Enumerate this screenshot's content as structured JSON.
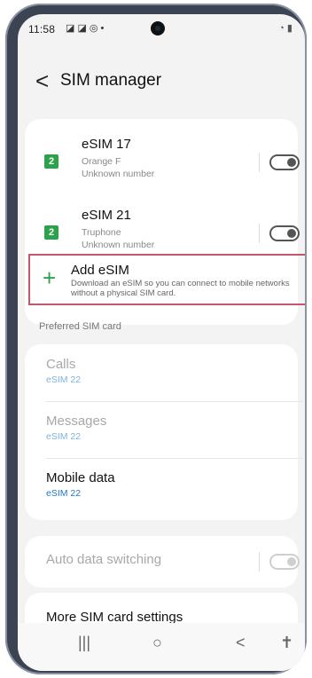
{
  "status": {
    "time": "11:58",
    "left_icons": "◪ ◪ ◎ •",
    "right_icons": "◔ ▮"
  },
  "header": {
    "back_icon": "chevron-left-icon",
    "title": "SIM manager"
  },
  "sims": [
    {
      "name": "eSIM 17",
      "carrier": "Orange F",
      "number": "Unknown number",
      "toggle": "off"
    },
    {
      "name": "eSIM 21",
      "carrier": "Truphone",
      "number": "Unknown number",
      "toggle": "off"
    }
  ],
  "add_esim": {
    "title": "Add eSIM",
    "description": "Download an eSIM so you can connect to mobile networks without a physical SIM card."
  },
  "preferred": {
    "section_label": "Preferred SIM card",
    "calls": {
      "label": "Calls",
      "value": "eSIM 22"
    },
    "messages": {
      "label": "Messages",
      "value": "eSIM 22"
    },
    "mobile_data": {
      "label": "Mobile data",
      "value": "eSIM 22"
    }
  },
  "auto_switch": {
    "label": "Auto data switching",
    "toggle": "off"
  },
  "more_settings": {
    "label": "More SIM card settings"
  },
  "nav": {
    "recents": "|||",
    "home": "○",
    "back": "<",
    "accessibility": "✝"
  },
  "colors": {
    "accent": "#2ea24a",
    "link": "#1f79c8",
    "disabled_link": "#7db3dd",
    "highlight": "#c1576b"
  }
}
